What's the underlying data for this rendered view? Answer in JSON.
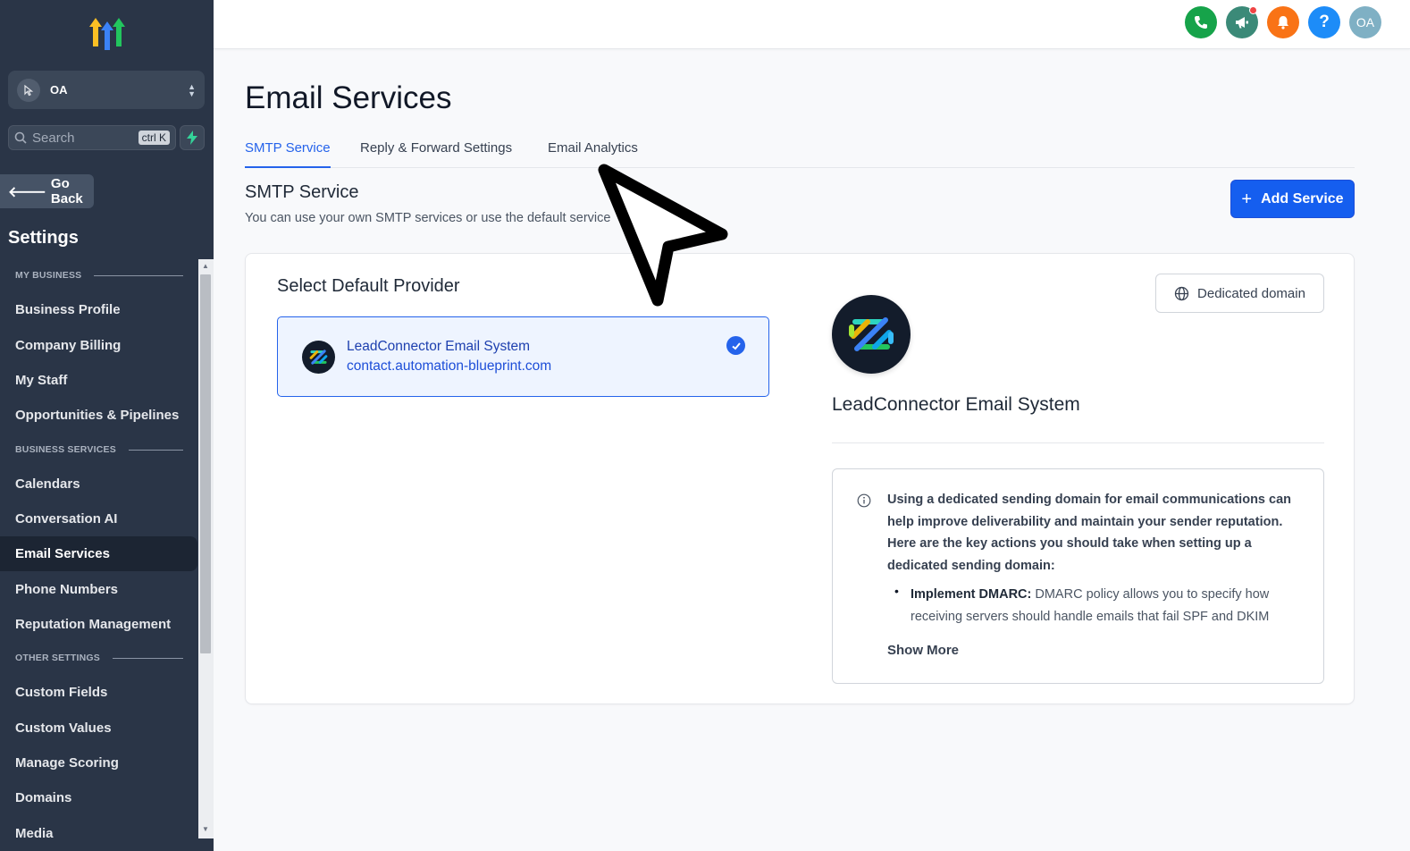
{
  "sidebar": {
    "account_initials": "OA",
    "search_placeholder": "Search",
    "search_shortcut": "ctrl K",
    "go_back_label": "Go Back",
    "settings_title": "Settings",
    "sections": {
      "my_business": "MY BUSINESS",
      "business_services": "BUSINESS SERVICES",
      "other_settings": "OTHER SETTINGS"
    },
    "items": [
      {
        "label": "Business Profile"
      },
      {
        "label": "Company Billing"
      },
      {
        "label": "My Staff"
      },
      {
        "label": "Opportunities & Pipelines"
      },
      {
        "label": "Calendars"
      },
      {
        "label": "Conversation AI"
      },
      {
        "label": "Email Services",
        "active": true
      },
      {
        "label": "Phone Numbers"
      },
      {
        "label": "Reputation Management"
      },
      {
        "label": "Custom Fields"
      },
      {
        "label": "Custom Values"
      },
      {
        "label": "Manage Scoring"
      },
      {
        "label": "Domains"
      },
      {
        "label": "Media"
      }
    ]
  },
  "topbar": {
    "icons": [
      "phone-icon",
      "megaphone-icon",
      "bell-icon",
      "help-icon",
      "user-avatar"
    ],
    "help_glyph": "?",
    "avatar_initials": "OA",
    "colors": {
      "phone": "#16a34a",
      "megaphone": "#3b8a78",
      "bell": "#f97316",
      "help": "#1d8cf8",
      "avatar": "#7fb0c4"
    }
  },
  "main": {
    "page_title": "Email Services",
    "tabs": [
      {
        "label": "SMTP Service",
        "active": true
      },
      {
        "label": "Reply & Forward Settings"
      },
      {
        "label": "Email Analytics"
      }
    ],
    "section_title": "SMTP Service",
    "section_subtitle": "You can use your own SMTP services or use the default service",
    "add_service_label": "Add Service",
    "card": {
      "heading": "Select Default Provider",
      "provider": {
        "name": "LeadConnector Email System",
        "domain": "contact.automation-blueprint.com",
        "selected": true
      },
      "dedicated_domain_label": "Dedicated domain",
      "detail_name": "LeadConnector Email System",
      "info": {
        "text": "Using a dedicated sending domain for email communications can help improve deliverability and maintain your sender reputation. Here are the key actions you should take when setting up a dedicated sending domain:",
        "bullet_title": "Implement DMARC:",
        "bullet_text": " DMARC policy allows you to specify how receiving servers should handle emails that fail SPF and DKIM",
        "show_more": "Show More"
      }
    }
  },
  "colors": {
    "sidebar_bg": "#2a3547",
    "accent": "#155eef",
    "active_tab": "#2563eb"
  }
}
